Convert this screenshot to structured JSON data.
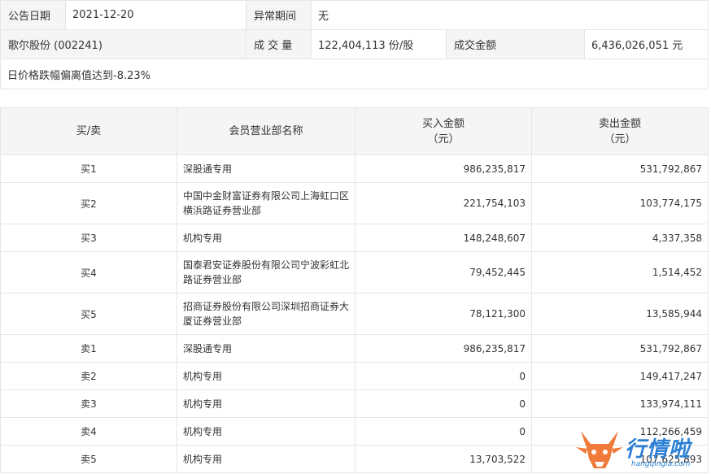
{
  "info": {
    "date_label": "公告日期",
    "date_value": "2021-12-20",
    "period_label": "异常期间",
    "period_value": "无",
    "stock_label": "歌尔股份 (002241)",
    "volume_label": "成 交 量",
    "volume_value": "122,404,113 份/股",
    "amount_label": "成交金额",
    "amount_value": "6,436,026,051 元",
    "note": "日价格跌幅偏离值达到-8.23%"
  },
  "table": {
    "headers": {
      "side": "买/卖",
      "branch": "会员营业部名称",
      "buy_line1": "买入金额",
      "buy_line2": "（元）",
      "sell_line1": "卖出金额",
      "sell_line2": "（元）"
    },
    "rows": [
      {
        "side": "买1",
        "branch": [
          "深股通专用"
        ],
        "buy": "986,235,817",
        "sell": "531,792,867"
      },
      {
        "side": "买2",
        "branch": [
          "中国中金财富证券有限公司上海虹口区",
          "横浜路证券营业部"
        ],
        "buy": "221,754,103",
        "sell": "103,774,175"
      },
      {
        "side": "买3",
        "branch": [
          "机构专用"
        ],
        "buy": "148,248,607",
        "sell": "4,337,358"
      },
      {
        "side": "买4",
        "branch": [
          "国泰君安证券股份有限公司宁波彩虹北",
          "路证券营业部"
        ],
        "buy": "79,452,445",
        "sell": "1,514,452"
      },
      {
        "side": "买5",
        "branch": [
          "招商证券股份有限公司深圳招商证券大",
          "厦证券营业部"
        ],
        "buy": "78,121,300",
        "sell": "13,585,944"
      },
      {
        "side": "卖1",
        "branch": [
          "深股通专用"
        ],
        "buy": "986,235,817",
        "sell": "531,792,867"
      },
      {
        "side": "卖2",
        "branch": [
          "机构专用"
        ],
        "buy": "0",
        "sell": "149,417,247"
      },
      {
        "side": "卖3",
        "branch": [
          "机构专用"
        ],
        "buy": "0",
        "sell": "133,974,111"
      },
      {
        "side": "卖4",
        "branch": [
          "机构专用"
        ],
        "buy": "0",
        "sell": "112,266,459"
      },
      {
        "side": "卖5",
        "branch": [
          "机构专用"
        ],
        "buy": "13,703,522",
        "sell": "107,625,893"
      }
    ]
  },
  "watermark": {
    "brand": "行情啦",
    "domain": "hangqingla.com",
    "icon": "bull-logo-icon",
    "color_brand": "#2b7fd4",
    "color_logo": "#f07a3a"
  }
}
